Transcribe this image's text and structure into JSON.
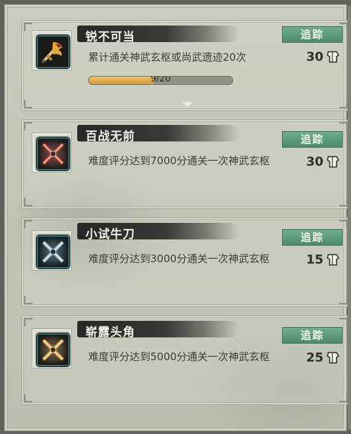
{
  "achievements": [
    {
      "title": "锐不可当",
      "track_label": "追踪",
      "description": "累计通关神武玄枢或尚武遗迹20次",
      "reward": "30",
      "icon": "golden-dragon-sword-icon",
      "progress": {
        "text": "9/20",
        "fraction": 0.45
      }
    },
    {
      "title": "百战无前",
      "track_label": "追踪",
      "description": "难度评分达到7000分通关一次神武玄枢",
      "reward": "30",
      "icon": "red-crossed-swords-icon"
    },
    {
      "title": "小试牛刀",
      "track_label": "追踪",
      "description": "难度评分达到3000分通关一次神武玄枢",
      "reward": "15",
      "icon": "blue-crossed-swords-icon"
    },
    {
      "title": "崭露头角",
      "track_label": "追踪",
      "description": "难度评分达到5000分通关一次神武玄枢",
      "reward": "25",
      "icon": "gold-crossed-swords-icon"
    }
  ],
  "reward_icon": "armor-currency-icon",
  "colors": {
    "track_button": "#5f9b7a",
    "progress_fill": "#e2aa4c",
    "title_brush": "#2a2c2a"
  }
}
